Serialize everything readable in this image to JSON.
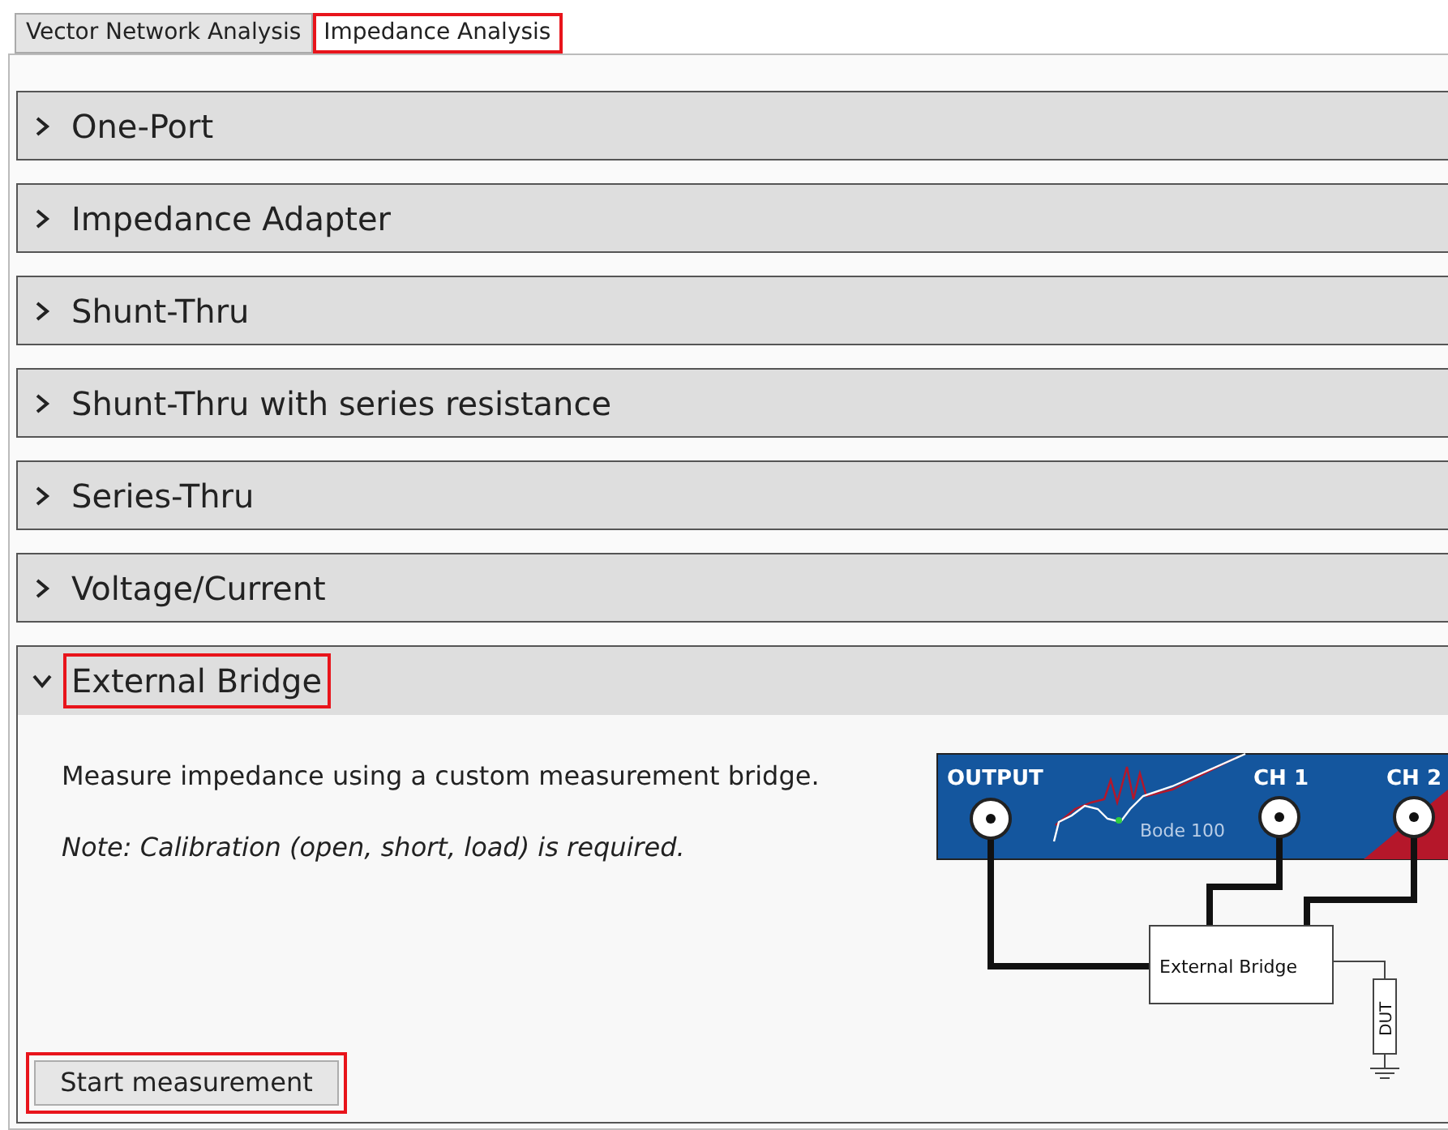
{
  "tabs": [
    {
      "label": "Vector Network Analysis",
      "selected": false,
      "highlighted": false
    },
    {
      "label": "Impedance Analysis",
      "selected": true,
      "highlighted": true
    }
  ],
  "sections": [
    {
      "title": "One-Port",
      "expanded": false,
      "highlighted": false
    },
    {
      "title": "Impedance Adapter",
      "expanded": false,
      "highlighted": false
    },
    {
      "title": "Shunt-Thru",
      "expanded": false,
      "highlighted": false
    },
    {
      "title": "Shunt-Thru with series resistance",
      "expanded": false,
      "highlighted": false
    },
    {
      "title": "Series-Thru",
      "expanded": false,
      "highlighted": false
    },
    {
      "title": "Voltage/Current",
      "expanded": false,
      "highlighted": false
    },
    {
      "title": "External Bridge",
      "expanded": true,
      "highlighted": true,
      "description": "Measure impedance using a custom measurement bridge.",
      "note": "Note: Calibration (open, short, load) is required.",
      "button": {
        "label": "Start measurement",
        "highlighted": true
      },
      "diagram": {
        "output_label": "OUTPUT",
        "ch1_label": "CH 1",
        "ch2_label": "CH 2",
        "device_label": "Bode 100",
        "bridge_label": "External Bridge",
        "dut_label": "DUT"
      }
    }
  ]
}
